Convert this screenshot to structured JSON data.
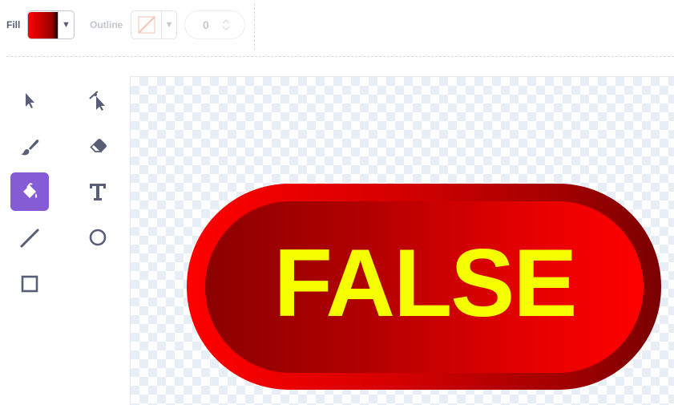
{
  "toolbar": {
    "fill_label": "Fill",
    "outline_label": "Outline",
    "stroke_width": "0",
    "fill_colors": [
      "#ff0000",
      "#8b0000"
    ],
    "accent": "#855cd6"
  },
  "tools": [
    {
      "name": "select-tool",
      "icon": "arrow-icon"
    },
    {
      "name": "reshape-tool",
      "icon": "reshape-icon"
    },
    {
      "name": "brush-tool",
      "icon": "brush-icon"
    },
    {
      "name": "eraser-tool",
      "icon": "eraser-icon"
    },
    {
      "name": "fill-tool",
      "icon": "paint-bucket-icon",
      "selected": true
    },
    {
      "name": "text-tool",
      "icon": "text-icon"
    },
    {
      "name": "line-tool",
      "icon": "line-icon"
    },
    {
      "name": "circle-tool",
      "icon": "circle-icon"
    },
    {
      "name": "rectangle-tool",
      "icon": "rectangle-icon"
    }
  ],
  "canvas": {
    "button_text": "FALSE",
    "text_color": "#f5ff00",
    "outer_colors": [
      "#ff0000",
      "#8b0000"
    ],
    "inner_colors": [
      "#8b0000",
      "#ff0000"
    ]
  }
}
